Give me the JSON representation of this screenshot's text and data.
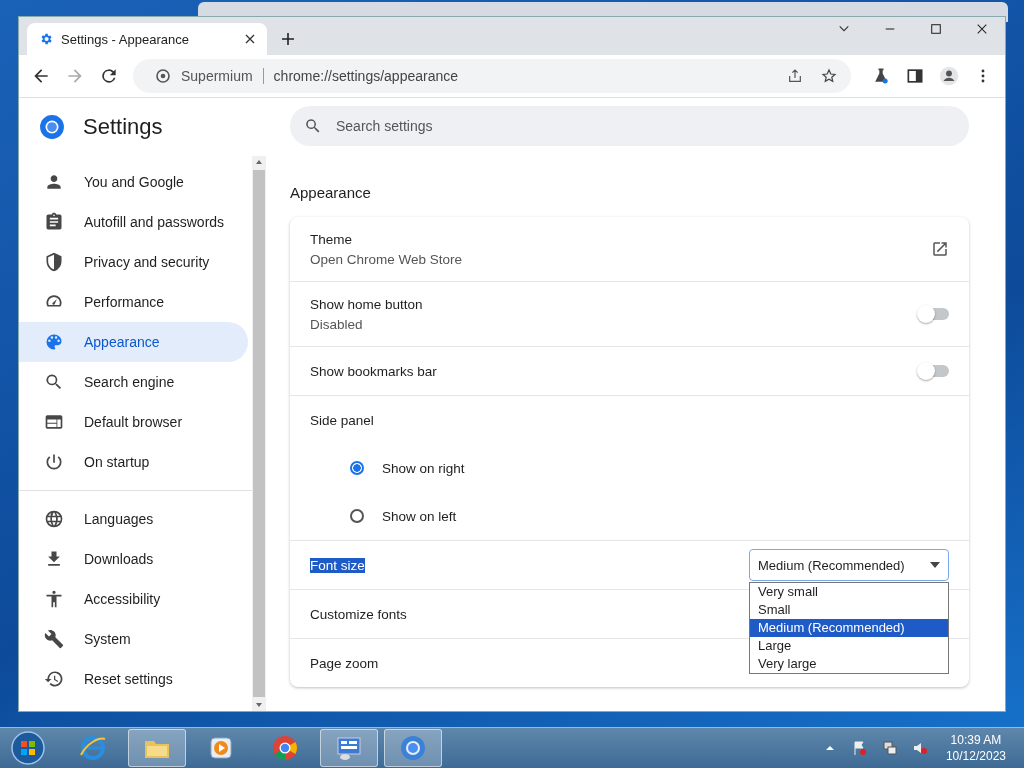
{
  "window": {
    "tab_title": "Settings - Appearance",
    "site_name": "Supermium",
    "url": "chrome://settings/appearance"
  },
  "sidebar": {
    "title": "Settings",
    "groups": [
      [
        {
          "label": "You and Google",
          "kind": "person",
          "selected": false
        },
        {
          "label": "Autofill and passwords",
          "kind": "clipboard",
          "selected": false
        },
        {
          "label": "Privacy and security",
          "kind": "shield",
          "selected": false
        },
        {
          "label": "Performance",
          "kind": "gauge",
          "selected": false
        },
        {
          "label": "Appearance",
          "kind": "palette",
          "selected": true
        },
        {
          "label": "Search engine",
          "kind": "search",
          "selected": false
        },
        {
          "label": "Default browser",
          "kind": "browser",
          "selected": false
        },
        {
          "label": "On startup",
          "kind": "power",
          "selected": false
        }
      ],
      [
        {
          "label": "Languages",
          "kind": "globe",
          "selected": false
        },
        {
          "label": "Downloads",
          "kind": "download",
          "selected": false
        },
        {
          "label": "Accessibility",
          "kind": "accessibility",
          "selected": false
        },
        {
          "label": "System",
          "kind": "wrench",
          "selected": false
        },
        {
          "label": "Reset settings",
          "kind": "history",
          "selected": false
        }
      ]
    ]
  },
  "search": {
    "placeholder": "Search settings"
  },
  "section_title": "Appearance",
  "rows": [
    {
      "kind": "link",
      "title": "Theme",
      "subtitle": "Open Chrome Web Store"
    },
    {
      "kind": "toggle",
      "title": "Show home button",
      "subtitle": "Disabled",
      "on": false
    },
    {
      "kind": "toggle",
      "title": "Show bookmarks bar",
      "on": false
    },
    {
      "kind": "radio",
      "title": "Side panel",
      "options": [
        {
          "label": "Show on right",
          "selected": true
        },
        {
          "label": "Show on left",
          "selected": false
        }
      ]
    },
    {
      "kind": "select",
      "title": "Font size",
      "title_highlighted": true,
      "value": "Medium (Recommended)",
      "expanded": true,
      "options": [
        {
          "label": "Very small",
          "selected": false
        },
        {
          "label": "Small",
          "selected": false
        },
        {
          "label": "Medium (Recommended)",
          "selected": true
        },
        {
          "label": "Large",
          "selected": false
        },
        {
          "label": "Very large",
          "selected": false
        }
      ]
    },
    {
      "kind": "plain",
      "title": "Customize fonts"
    },
    {
      "kind": "plain",
      "title": "Page zoom"
    }
  ],
  "taskbar": {
    "apps": [
      {
        "kind": "ie",
        "selected": false
      },
      {
        "kind": "folder",
        "selected": true
      },
      {
        "kind": "media",
        "selected": false
      },
      {
        "kind": "chrome",
        "selected": false
      },
      {
        "kind": "panel",
        "selected": true
      },
      {
        "kind": "chromium",
        "selected": true
      }
    ],
    "time": "10:39 AM",
    "date": "10/12/2023"
  }
}
